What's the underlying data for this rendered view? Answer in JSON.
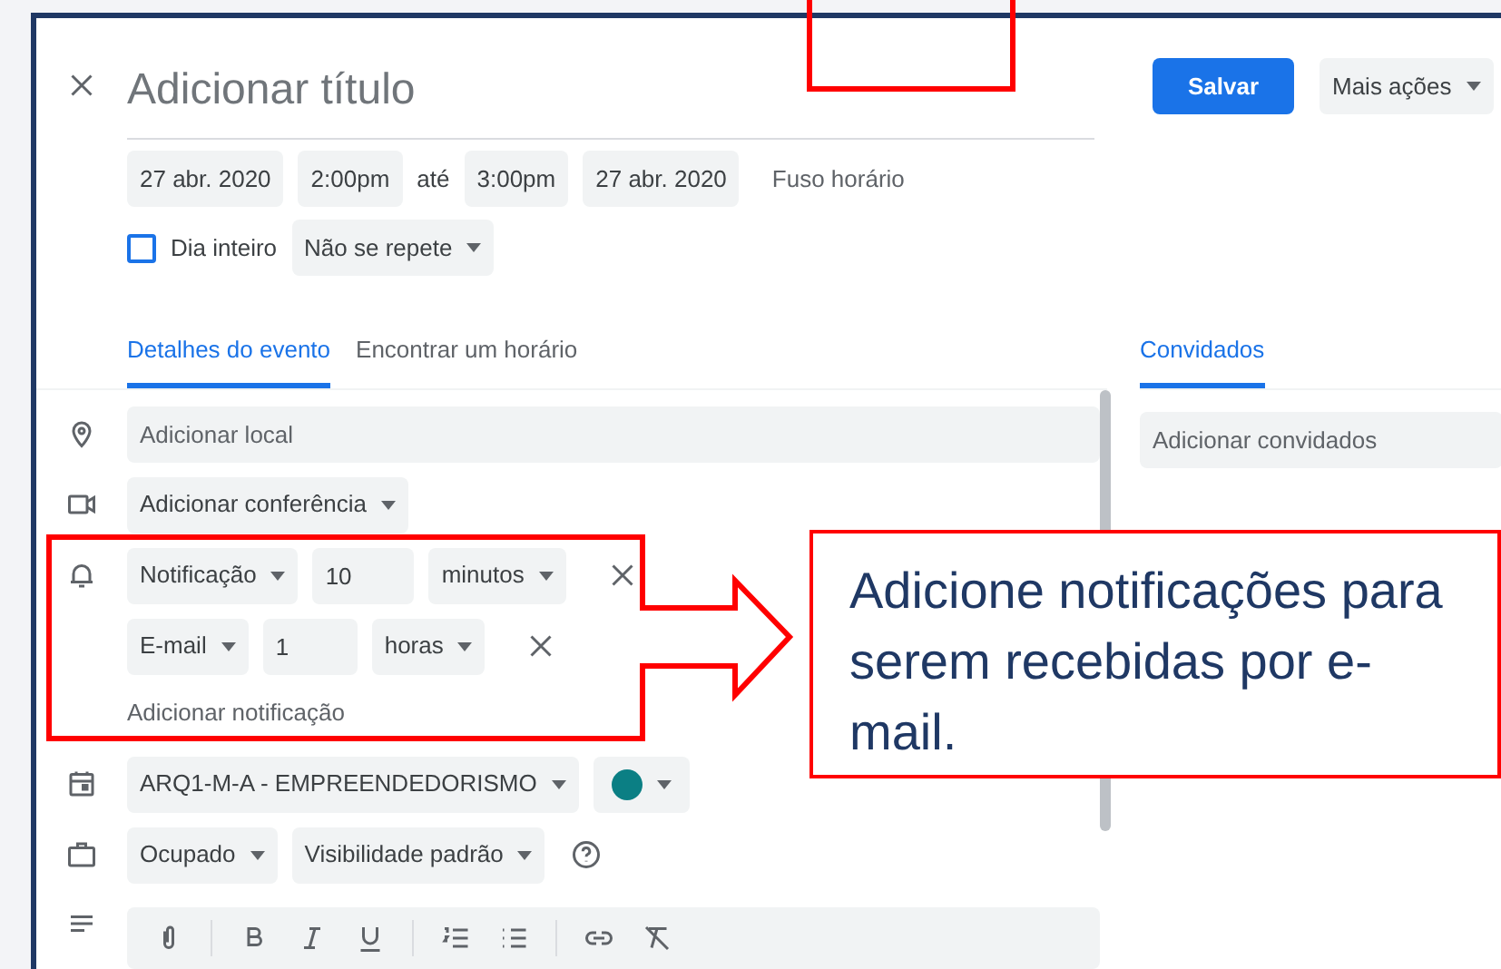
{
  "title_field": {
    "placeholder": "Adicionar título"
  },
  "actions": [
    {
      "label": "Salvar",
      "kind": "primary"
    },
    {
      "label": "Mais ações",
      "kind": "menu"
    }
  ],
  "dates": {
    "start_date": "27 abr. 2020",
    "start_time": "2:00pm",
    "separator": "até",
    "end_time": "3:00pm",
    "end_date": "27 abr. 2020",
    "timezone": "Fuso horário"
  },
  "all_day": {
    "label": "Dia inteiro",
    "checked": false
  },
  "repeat": "Não se repete",
  "tabs": [
    {
      "label": "Detalhes do evento",
      "selected": true
    },
    {
      "label": "Encontrar um horário",
      "selected": false
    }
  ],
  "location": {
    "placeholder": "Adicionar local"
  },
  "conference": "Adicionar conferência",
  "notifications": [
    {
      "method": "Notificação",
      "amount": "10",
      "unit": "minutos"
    },
    {
      "method": "E-mail",
      "amount": "1",
      "unit": "horas"
    }
  ],
  "add_notification": "Adicionar notificação",
  "calendar": {
    "name": "ARQ1-M-A - EMPREENDEDORISMO",
    "color": "#0b7f84"
  },
  "availability": "Ocupado",
  "visibility": "Visibilidade padrão",
  "guests": {
    "tab": {
      "label": "Convidados",
      "selected": true
    },
    "placeholder": "Adicionar convidados"
  },
  "callout": "Adicione notificações para serem recebidas por e-mail."
}
